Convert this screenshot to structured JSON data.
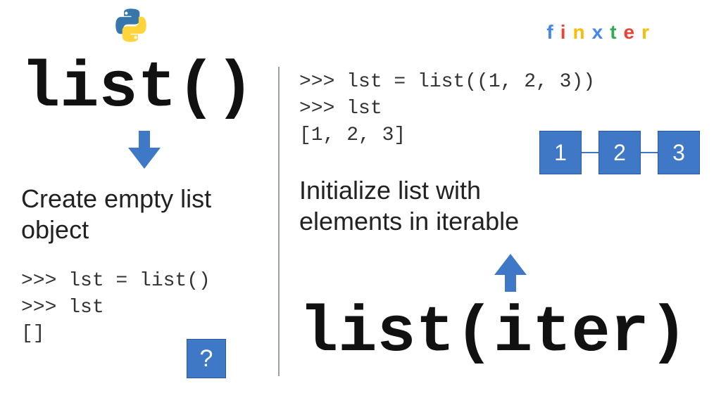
{
  "brand": {
    "chars": [
      "f",
      "i",
      "n",
      "x",
      "t",
      "e",
      "r"
    ]
  },
  "left": {
    "heading": "list()",
    "caption": "Create empty list\nobject",
    "code": ">>> lst = list()\n>>> lst\n[]",
    "qmark_label": "?"
  },
  "right": {
    "code": ">>> lst = list((1, 2, 3))\n>>> lst\n[1, 2, 3]",
    "nodes": [
      "1",
      "2",
      "3"
    ],
    "caption": "Initialize list with\nelements in iterable",
    "heading": "list(iter)"
  },
  "colors": {
    "accent": "#3e78c7"
  }
}
